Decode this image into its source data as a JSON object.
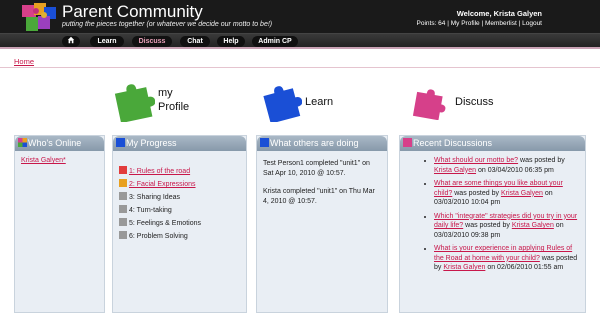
{
  "header": {
    "title": "Parent Community",
    "motto": "putting the pieces together (or whatever we decide our motto to be!)",
    "welcome": "Welcome, Krista Galyen",
    "points_label": "Points: 64",
    "sep": "|",
    "my_profile": "My Profile",
    "memberlist": "Memberlist",
    "logout": "Logout"
  },
  "nav": {
    "home_icon": "home-icon",
    "items": [
      "Learn",
      "Discuss",
      "Chat",
      "Help",
      "Admin CP"
    ],
    "active": "Discuss"
  },
  "breadcrumb": "Home",
  "big_icons": [
    {
      "label_line1": "my",
      "label_line2": "Profile",
      "color": "#4aa83a"
    },
    {
      "label": "Learn",
      "color": "#1a4fd6"
    },
    {
      "label": "Discuss",
      "color": "#d6408a"
    }
  ],
  "panels": {
    "whos_online": {
      "title": "Who's Online",
      "users": [
        "Krista Galyen*"
      ]
    },
    "my_progress": {
      "title": "My Progress",
      "items": [
        {
          "text": "1: Rules of the road",
          "link": true,
          "color": "#e23c3c"
        },
        {
          "text": "2: Facial Expressions",
          "link": true,
          "color": "#e8a020"
        },
        {
          "text": "3: Sharing Ideas",
          "link": false,
          "color": "#999999"
        },
        {
          "text": "4: Turn-taking",
          "link": false,
          "color": "#999999"
        },
        {
          "text": "5: Feelings & Emotions",
          "link": false,
          "color": "#999999"
        },
        {
          "text": "6: Problem Solving",
          "link": false,
          "color": "#999999"
        }
      ]
    },
    "others": {
      "title": "What others are doing",
      "entries": [
        "Test Person1 completed \"unit1\" on Sat Apr 10, 2010 @ 10:57.",
        "Krista completed \"unit1\" on Thu Mar 4, 2010 @ 10:57."
      ]
    },
    "recent": {
      "title": "Recent Discussions",
      "items": [
        {
          "topic": "What should our motto be?",
          "mid": " was posted by ",
          "author": "Krista Galyen",
          "tail": " on 03/04/2010 06:35 pm"
        },
        {
          "topic": "What are some things you like about your child?",
          "mid": " was posted by ",
          "author": "Krista Galyen",
          "tail": " on 03/03/2010 10:04 pm"
        },
        {
          "topic": "Which \"integrate\" strategies did you try in your daily life?",
          "mid": " was posted by ",
          "author": "Krista Galyen",
          "tail": " on 03/03/2010 09:38 pm"
        },
        {
          "topic": "What is your experience in applying Rules of the Road at home with your child?",
          "mid": " was posted by ",
          "author": "Krista Galyen",
          "tail": " on 02/06/2010 01:55 am"
        }
      ]
    }
  }
}
